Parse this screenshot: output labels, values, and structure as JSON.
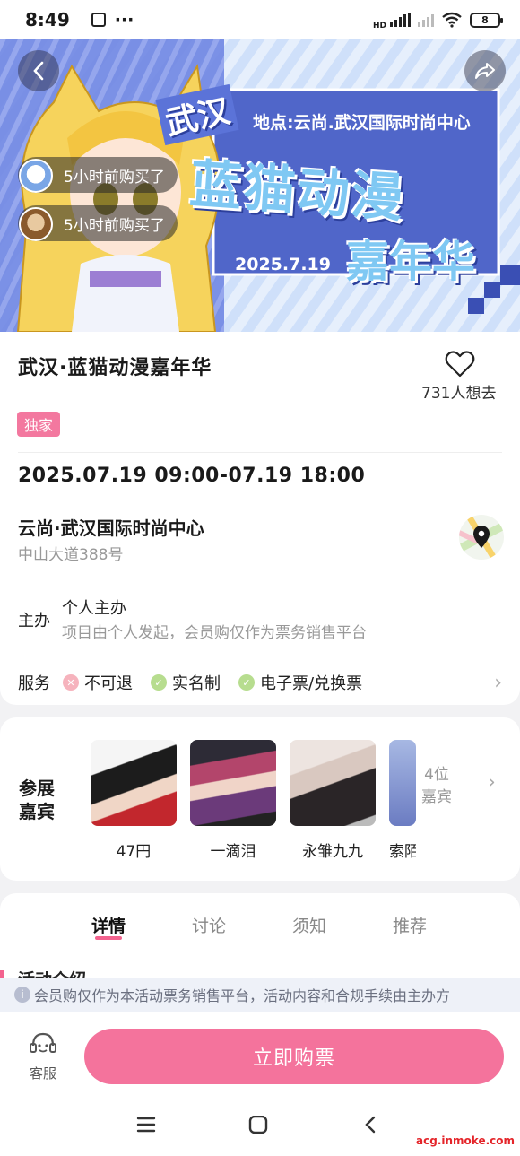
{
  "status_bar": {
    "time": "8:49",
    "more": "···",
    "hd": "HD",
    "battery": "8"
  },
  "banner": {
    "city": "武汉",
    "location_line": "地点:云尚.武汉国际时尚中心",
    "name_line1": "蓝猫动漫",
    "name_line2": "嘉年华",
    "date": "2025.7.19",
    "toasts": [
      "5小时前购买了",
      "5小时前购买了"
    ]
  },
  "event": {
    "title": "武汉·蓝猫动漫嘉年华",
    "want_count": "731人想去",
    "tag": "独家",
    "datetime": "2025.07.19 09:00-07.19 18:00",
    "venue": "云尚·武汉国际时尚中心",
    "address": "中山大道388号",
    "organizer_label": "主办",
    "organizer_name": "个人主办",
    "organizer_desc": "项目由个人发起，会员购仅作为票务销售平台",
    "services_label": "服务",
    "services": [
      {
        "label": "不可退",
        "ok": false
      },
      {
        "label": "实名制",
        "ok": true
      },
      {
        "label": "电子票/兑换票",
        "ok": true
      }
    ]
  },
  "guests": {
    "label_line1": "参展",
    "label_line2": "嘉宾",
    "items": [
      {
        "name": "47円"
      },
      {
        "name": "一滴泪"
      },
      {
        "name": "永雏九九"
      },
      {
        "name": "索陌"
      }
    ],
    "more_count": "4位",
    "more_label": "嘉宾"
  },
  "tabs": [
    "详情",
    "讨论",
    "须知",
    "推荐"
  ],
  "section_heading": "活动介绍",
  "notice": "会员购仅作为本活动票务销售平台，活动内容和合规手续由主办方",
  "bottom": {
    "service_label": "客服",
    "buy_label": "立即购票"
  },
  "watermark": "acg.inmoke.com",
  "colors": {
    "accent_pink": "#f4739c",
    "tag_pink": "#f3789f",
    "banner_blue": "#5b73d8"
  }
}
